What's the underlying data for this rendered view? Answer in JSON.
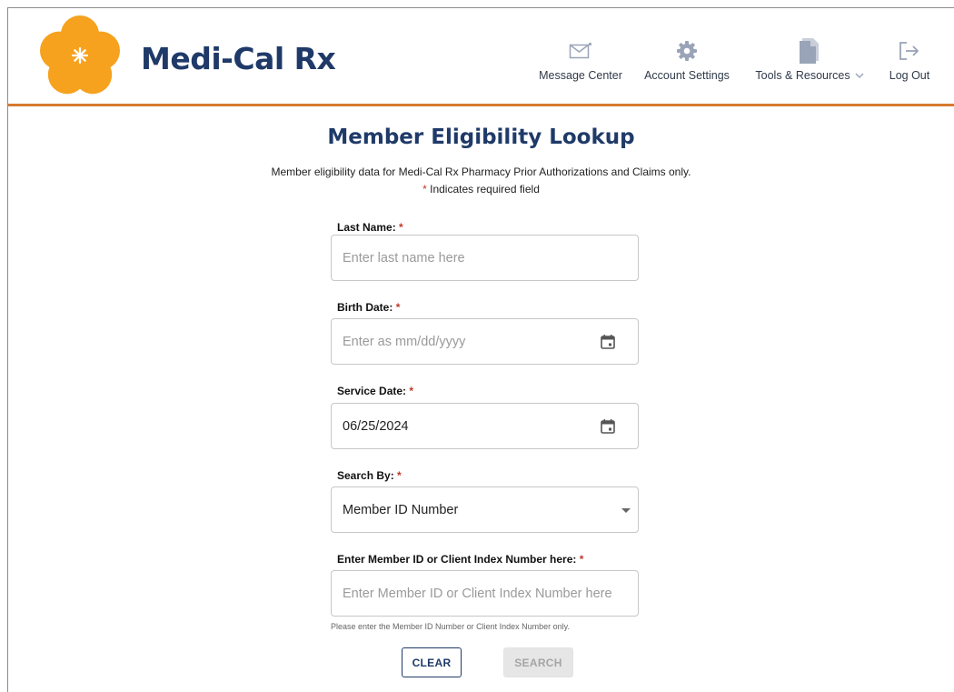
{
  "header": {
    "brand": "Medi-Cal Rx",
    "nav": {
      "message_center": "Message Center",
      "account_settings": "Account Settings",
      "tools_resources": "Tools & Resources",
      "log_out": "Log Out"
    },
    "accent_color": "#d77a2f",
    "brand_color": "#1f3a68",
    "logo_color": "#f6a21e"
  },
  "page": {
    "title": "Member Eligibility Lookup",
    "subtitle": "Member eligibility data for Medi-Cal Rx Pharmacy Prior Authorizations and Claims only.",
    "required_star": "*",
    "required_note": "Indicates required field"
  },
  "form": {
    "last_name": {
      "label": "Last Name:",
      "placeholder": "Enter last name here",
      "value": ""
    },
    "birth_date": {
      "label": "Birth Date:",
      "placeholder": "Enter as mm/dd/yyyy",
      "value": ""
    },
    "service_date": {
      "label": "Service Date:",
      "value": "06/25/2024"
    },
    "search_by": {
      "label": "Search By:",
      "selected": "Member ID Number"
    },
    "member_id": {
      "label": "Enter Member ID or Client Index Number here:",
      "placeholder": "Enter Member ID or Client Index Number here",
      "hint": "Please enter the Member ID Number or Client Index Number only."
    },
    "buttons": {
      "clear": "CLEAR",
      "search": "SEARCH"
    }
  },
  "icons": {
    "logo": "poppy-flower-icon",
    "message_center": "envelope-icon",
    "account_settings": "gear-icon",
    "tools_resources": "document-icon",
    "log_out": "logout-icon",
    "date": "calendar-icon",
    "dropdown": "caret-down-icon"
  }
}
